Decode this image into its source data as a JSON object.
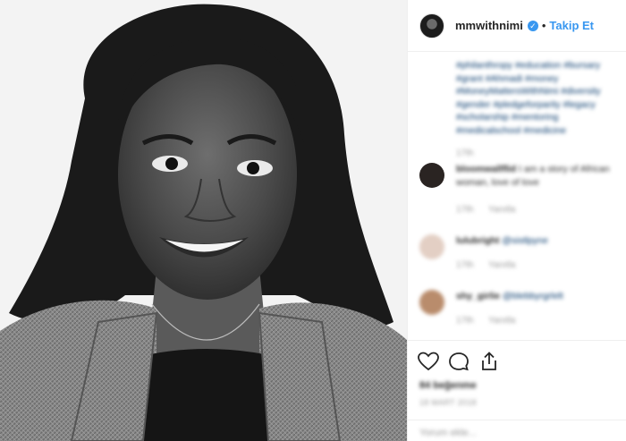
{
  "photo": {
    "alt_icon": "portrait-photo"
  },
  "header": {
    "username": "mmwithnimi",
    "verified_icon": "verified-badge-icon",
    "verified_glyph": "✓",
    "separator": "•",
    "follow_label": "Takip Et"
  },
  "caption": {
    "hashtags": "#philanthropy #education #bursary #grant #Ahmadi #money #MoneyMattersWithNimi #diversity #gender #pledgeforparity #legacy #scholarship #mentoring #medicalschool #medicine",
    "time": "17th"
  },
  "comments": [
    {
      "user": "bloomwallflid",
      "text": "I am a story of African woman, love of love",
      "time": "17th",
      "reply": "Yanıtla",
      "avatar_color": "#2a2422"
    },
    {
      "user": "lulubright",
      "text": "@sistlpyne",
      "time": "17th",
      "reply": "Yanıtla",
      "avatar_color": "#e3cfc4"
    },
    {
      "user": "shy_girlie",
      "text": "@blebbyrgrlelt",
      "time": "17th",
      "reply": "Yanıtla",
      "avatar_color": "#b98c6c"
    }
  ],
  "actions": {
    "like_icon": "heart-icon",
    "comment_icon": "comment-bubble-icon",
    "share_icon": "share-icon",
    "likes": "84 beğenme",
    "date": "18 MART 2018",
    "add_comment_placeholder": "Yorum ekle..."
  }
}
